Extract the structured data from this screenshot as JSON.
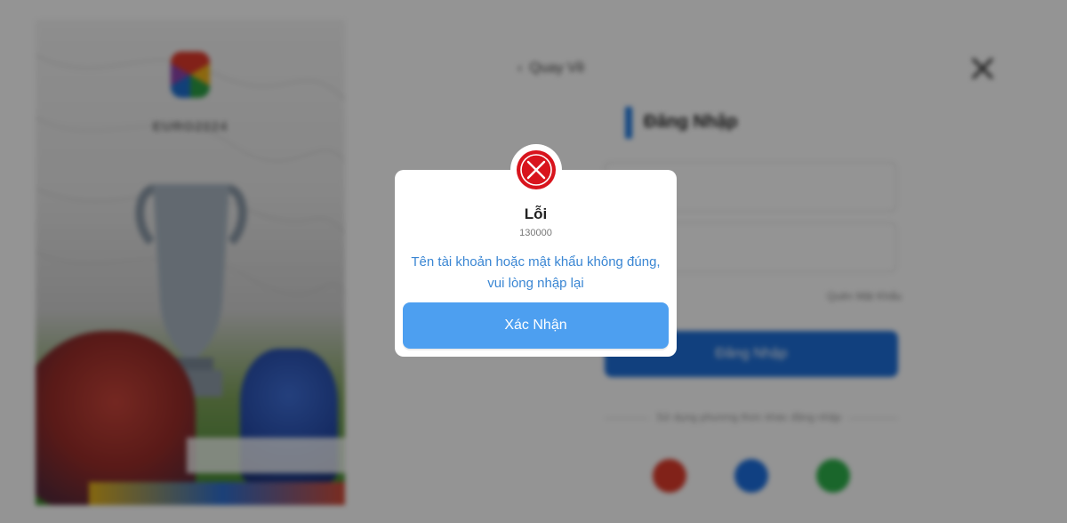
{
  "background": {
    "hero": {
      "logo_text": "EURO2024"
    },
    "back_label": "Quay Về",
    "login_title": "Đăng Nhập",
    "forgot_label": "Quên Mật Khẩu",
    "login_button": "Đăng Nhập",
    "divider_text": "Sử dụng phương thức khác đăng nhập",
    "social_icons": [
      "google-icon",
      "zalo-icon",
      "phone-icon"
    ]
  },
  "modal": {
    "title": "Lỗi",
    "code": "130000",
    "message": "Tên tài khoản hoặc mật khẩu không đúng, vui lòng nhập lại",
    "confirm_label": "Xác Nhận",
    "error_color": "#d8141d",
    "accent_color": "#4d9ff0"
  }
}
